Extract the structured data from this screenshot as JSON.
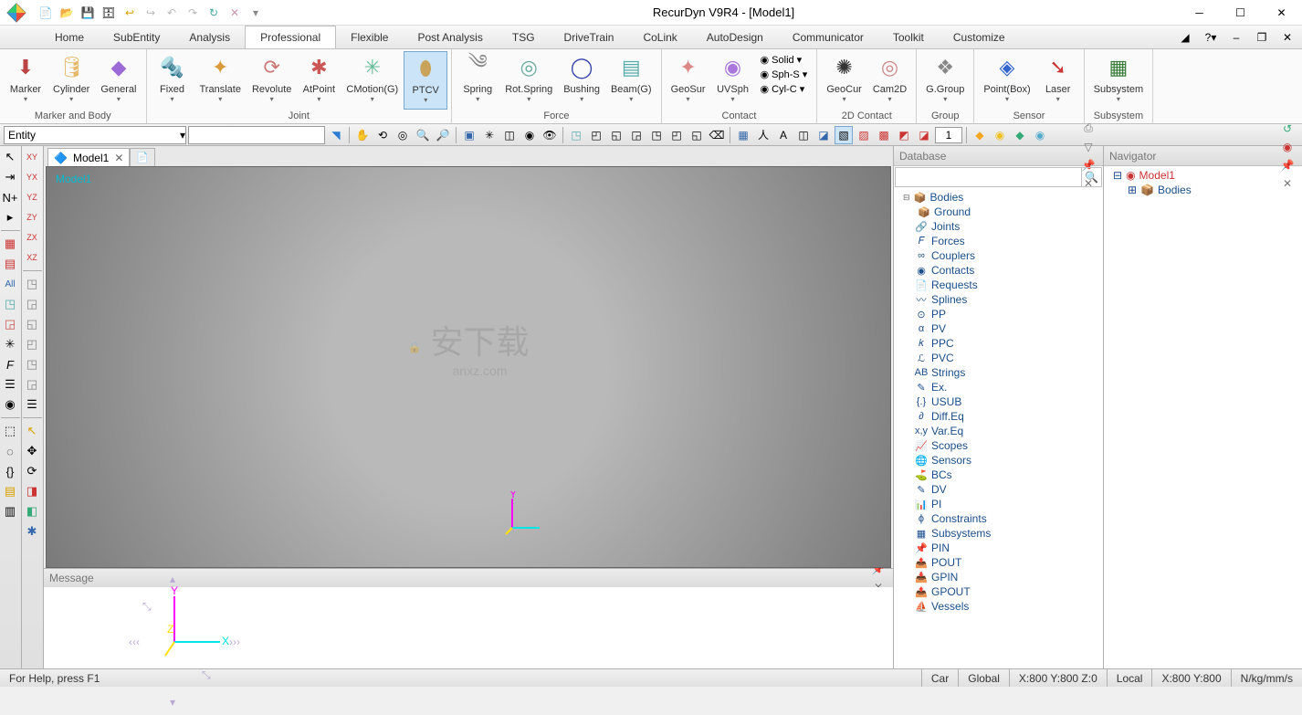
{
  "app": {
    "title": "RecurDyn V9R4  - [Model1]"
  },
  "menu": {
    "tabs": [
      "Home",
      "SubEntity",
      "Analysis",
      "Professional",
      "Flexible",
      "Post Analysis",
      "TSG",
      "DriveTrain",
      "CoLink",
      "AutoDesign",
      "Communicator",
      "Toolkit",
      "Customize"
    ],
    "active": 3
  },
  "ribbon": {
    "groups": [
      {
        "label": "Marker and Body",
        "buttons": [
          {
            "label": "Marker",
            "icon": "⬇",
            "color": "#b44"
          },
          {
            "label": "Cylinder",
            "icon": "🛢",
            "color": "#e6b96a"
          },
          {
            "label": "General",
            "icon": "◆",
            "color": "#9c6ad6"
          }
        ]
      },
      {
        "label": "Joint",
        "buttons": [
          {
            "label": "Fixed",
            "icon": "🔩",
            "color": "#888"
          },
          {
            "label": "Translate",
            "icon": "✦",
            "color": "#d99b3a"
          },
          {
            "label": "Revolute",
            "icon": "⟳",
            "color": "#c77"
          },
          {
            "label": "AtPoint",
            "icon": "✱",
            "color": "#c55"
          },
          {
            "label": "CMotion(G)",
            "icon": "✳",
            "color": "#6b9"
          },
          {
            "label": "PTCV",
            "icon": "⬮",
            "color": "#caa35a",
            "active": true
          }
        ]
      },
      {
        "label": "Force",
        "buttons": [
          {
            "label": "Spring",
            "icon": "༄",
            "color": "#888"
          },
          {
            "label": "Rot.Spring",
            "icon": "◎",
            "color": "#6a9"
          },
          {
            "label": "Bushing",
            "icon": "◯",
            "color": "#34a"
          },
          {
            "label": "Beam(G)",
            "icon": "▤",
            "color": "#5aa"
          }
        ]
      },
      {
        "label": "Contact",
        "buttons": [
          {
            "label": "GeoSur",
            "icon": "✦",
            "color": "#d88"
          },
          {
            "label": "UVSph",
            "icon": "◉",
            "color": "#a7d"
          }
        ],
        "stack": [
          "Solid ▾",
          "Sph-S ▾",
          "Cyl-C ▾"
        ]
      },
      {
        "label": "2D Contact",
        "buttons": [
          {
            "label": "GeoCur",
            "icon": "✺",
            "color": "#333"
          },
          {
            "label": "Cam2D",
            "icon": "◎",
            "color": "#c88"
          }
        ]
      },
      {
        "label": "Group",
        "buttons": [
          {
            "label": "G.Group",
            "icon": "❖",
            "color": "#888"
          }
        ]
      },
      {
        "label": "Sensor",
        "buttons": [
          {
            "label": "Point(Box)",
            "icon": "◈",
            "color": "#36c"
          },
          {
            "label": "Laser",
            "icon": "➘",
            "color": "#c33"
          }
        ]
      },
      {
        "label": "Subsystem",
        "buttons": [
          {
            "label": "Subsystem",
            "icon": "▦",
            "color": "#3a7d3a"
          }
        ]
      }
    ]
  },
  "toolbar2": {
    "entity": "Entity",
    "gridNum": "1"
  },
  "doc": {
    "tab": "Model1",
    "vpLabel": "Model1"
  },
  "database": {
    "title": "Database",
    "items": [
      {
        "label": "Bodies",
        "icon": "📦",
        "indent": 0,
        "exp": true
      },
      {
        "label": "Ground",
        "icon": "📦",
        "indent": 1
      },
      {
        "label": "Joints",
        "icon": "🔗",
        "indent": 0
      },
      {
        "label": "Forces",
        "icon": "𝐹",
        "indent": 0
      },
      {
        "label": "Couplers",
        "icon": "∞",
        "indent": 0
      },
      {
        "label": "Contacts",
        "icon": "◉",
        "indent": 0
      },
      {
        "label": "Requests",
        "icon": "📄",
        "indent": 0
      },
      {
        "label": "Splines",
        "icon": "〰",
        "indent": 0
      },
      {
        "label": "PP",
        "icon": "⊙",
        "indent": 0
      },
      {
        "label": "PV",
        "icon": "α",
        "indent": 0
      },
      {
        "label": "PPC",
        "icon": "𝑘",
        "indent": 0
      },
      {
        "label": "PVC",
        "icon": "ℒ",
        "indent": 0
      },
      {
        "label": "Strings",
        "icon": "AB",
        "indent": 0
      },
      {
        "label": "Ex.",
        "icon": "✎",
        "indent": 0
      },
      {
        "label": "USUB",
        "icon": "{.}",
        "indent": 0
      },
      {
        "label": "Diff.Eq",
        "icon": "∂",
        "indent": 0
      },
      {
        "label": "Var.Eq",
        "icon": "x,y",
        "indent": 0
      },
      {
        "label": "Scopes",
        "icon": "📈",
        "indent": 0
      },
      {
        "label": "Sensors",
        "icon": "🌐",
        "indent": 0
      },
      {
        "label": "BCs",
        "icon": "⛳",
        "indent": 0
      },
      {
        "label": "DV",
        "icon": "✎",
        "indent": 0
      },
      {
        "label": "PI",
        "icon": "📊",
        "indent": 0
      },
      {
        "label": "Constraints",
        "icon": "ϕ",
        "indent": 0
      },
      {
        "label": "Subsystems",
        "icon": "▦",
        "indent": 0
      },
      {
        "label": "PIN",
        "icon": "📌",
        "indent": 0
      },
      {
        "label": "POUT",
        "icon": "📤",
        "indent": 0
      },
      {
        "label": "GPIN",
        "icon": "📥",
        "indent": 0
      },
      {
        "label": "GPOUT",
        "icon": "📤",
        "indent": 0
      },
      {
        "label": "Vessels",
        "icon": "⛵",
        "indent": 0
      }
    ]
  },
  "navigator": {
    "title": "Navigator",
    "root": "Model1",
    "child": "Bodies"
  },
  "message": {
    "title": "Message"
  },
  "status": {
    "help": "For Help, press F1",
    "car": "Car",
    "global": "Global",
    "gcoord": "X:800 Y:800 Z:0",
    "local": "Local",
    "lcoord": "X:800 Y:800",
    "units": "N/kg/mm/s"
  }
}
